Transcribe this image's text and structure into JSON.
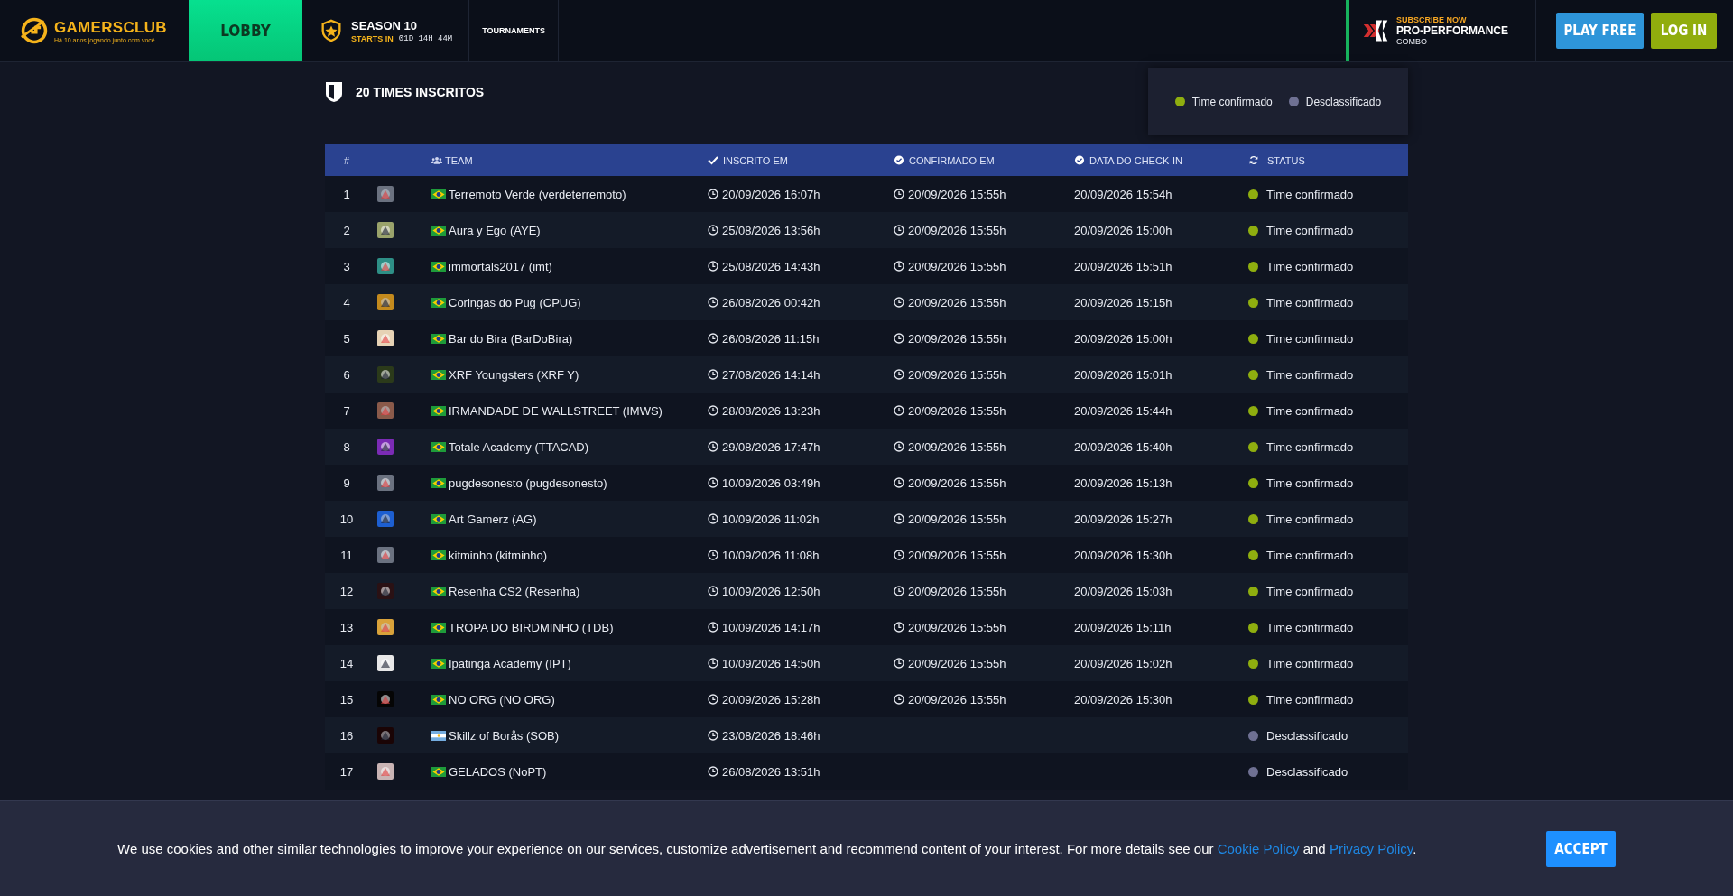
{
  "header": {
    "logo": {
      "name": "GAMERSCLUB",
      "tagline": "Há 10 anos jogando junto com você."
    },
    "nav": [
      {
        "label": "LOBBY",
        "selected": true
      }
    ],
    "season": {
      "title": "SEASON 10",
      "starts_label": "STARTS IN",
      "countdown": "01D 14H 44M"
    },
    "nav_more": [
      {
        "label": "TOURNAMENTS",
        "selected": false
      }
    ],
    "promo": {
      "eyebrow": "SUBSCRIBE NOW",
      "title": "PRO-PERFORMANCE",
      "subtitle": "COMBO"
    },
    "buttons": [
      {
        "label": "PLAY FREE",
        "kind": "play"
      },
      {
        "label": "LOG IN",
        "kind": "login"
      }
    ]
  },
  "section": {
    "title": "20 TIMES INSCRITOS"
  },
  "legend": [
    {
      "label": "Time confirmado",
      "color": "#8fae0f"
    },
    {
      "label": "Desclassificado",
      "color": "#6f7193"
    }
  ],
  "table": {
    "columns": [
      "#",
      "TEAM",
      "INSCRITO EM",
      "CONFIRMADO EM",
      "DATA DO CHECK-IN",
      "STATUS"
    ],
    "rows": [
      {
        "n": "1",
        "team": "Terremoto Verde (verdeterremoto)",
        "kind": "brazil",
        "inscrito": "20/09/2026 16:07h",
        "confirmado": "20/09/2026 15:55h",
        "checkin": "20/09/2026 15:54h",
        "status": "Time confirmado",
        "color": "#8fae0f"
      },
      {
        "n": "2",
        "team": "Aura y Ego (AYE)",
        "kind": "brazil",
        "inscrito": "25/08/2026 13:56h",
        "confirmado": "20/09/2026 15:55h",
        "checkin": "20/09/2026 15:00h",
        "status": "Time confirmado",
        "color": "#8fae0f"
      },
      {
        "n": "3",
        "team": "immortals2017 (imt)",
        "kind": "brazil",
        "inscrito": "25/08/2026 14:43h",
        "confirmado": "20/09/2026 15:55h",
        "checkin": "20/09/2026 15:51h",
        "status": "Time confirmado",
        "color": "#8fae0f"
      },
      {
        "n": "4",
        "team": "Coringas do Pug (CPUG)",
        "kind": "brazil",
        "inscrito": "26/08/2026 00:42h",
        "confirmado": "20/09/2026 15:55h",
        "checkin": "20/09/2026 15:15h",
        "status": "Time confirmado",
        "color": "#8fae0f"
      },
      {
        "n": "5",
        "team": "Bar do Bira (BarDoBira)",
        "kind": "brazil",
        "inscrito": "26/08/2026 11:15h",
        "confirmado": "20/09/2026 15:55h",
        "checkin": "20/09/2026 15:00h",
        "status": "Time confirmado",
        "color": "#8fae0f"
      },
      {
        "n": "6",
        "team": "XRF Youngsters (XRF Y)",
        "kind": "brazil",
        "inscrito": "27/08/2026 14:14h",
        "confirmado": "20/09/2026 15:55h",
        "checkin": "20/09/2026 15:01h",
        "status": "Time confirmado",
        "color": "#8fae0f"
      },
      {
        "n": "7",
        "team": "IRMANDADE DE WALLSTREET (IMWS)",
        "kind": "brazil",
        "inscrito": "28/08/2026 13:23h",
        "confirmado": "20/09/2026 15:55h",
        "checkin": "20/09/2026 15:44h",
        "status": "Time confirmado",
        "color": "#8fae0f"
      },
      {
        "n": "8",
        "team": "Totale Academy (TTACAD)",
        "kind": "brazil",
        "inscrito": "29/08/2026 17:47h",
        "confirmado": "20/09/2026 15:55h",
        "checkin": "20/09/2026 15:40h",
        "status": "Time confirmado",
        "color": "#8fae0f"
      },
      {
        "n": "9",
        "team": "pugdesonesto (pugdesonesto)",
        "kind": "brazil",
        "inscrito": "10/09/2026 03:49h",
        "confirmado": "20/09/2026 15:55h",
        "checkin": "20/09/2026 15:13h",
        "status": "Time confirmado",
        "color": "#8fae0f"
      },
      {
        "n": "10",
        "team": "Art Gamerz (AG)",
        "kind": "brazil",
        "inscrito": "10/09/2026 11:02h",
        "confirmado": "20/09/2026 15:55h",
        "checkin": "20/09/2026 15:27h",
        "status": "Time confirmado",
        "color": "#8fae0f"
      },
      {
        "n": "11",
        "team": "kitminho (kitminho)",
        "kind": "brazil",
        "inscrito": "10/09/2026 11:08h",
        "confirmado": "20/09/2026 15:55h",
        "checkin": "20/09/2026 15:30h",
        "status": "Time confirmado",
        "color": "#8fae0f"
      },
      {
        "n": "12",
        "team": "Resenha CS2 (Resenha)",
        "kind": "brazil",
        "inscrito": "10/09/2026 12:50h",
        "confirmado": "20/09/2026 15:55h",
        "checkin": "20/09/2026 15:03h",
        "status": "Time confirmado",
        "color": "#8fae0f"
      },
      {
        "n": "13",
        "team": "TROPA DO BIRDMINHO (TDB)",
        "kind": "brazil",
        "inscrito": "10/09/2026 14:17h",
        "confirmado": "20/09/2026 15:55h",
        "checkin": "20/09/2026 15:11h",
        "status": "Time confirmado",
        "color": "#8fae0f"
      },
      {
        "n": "14",
        "team": "Ipatinga Academy (IPT)",
        "kind": "brazil",
        "inscrito": "10/09/2026 14:50h",
        "confirmado": "20/09/2026 15:55h",
        "checkin": "20/09/2026 15:02h",
        "status": "Time confirmado",
        "color": "#8fae0f"
      },
      {
        "n": "15",
        "team": "NO ORG (NO ORG)",
        "kind": "brazil",
        "inscrito": "20/09/2026 15:28h",
        "confirmado": "20/09/2026 15:55h",
        "checkin": "20/09/2026 15:30h",
        "status": "Time confirmado",
        "color": "#8fae0f"
      },
      {
        "n": "16",
        "team": "Skillz of Borås (SOB)",
        "kind": "argentina",
        "inscrito": "23/08/2026 18:46h",
        "status": "Desclassificado",
        "color": "#6f7193"
      },
      {
        "n": "17",
        "team": "GELADOS (NoPT)",
        "kind": "brazil",
        "inscrito": "26/08/2026 13:51h",
        "status": "Desclassificado",
        "color": "#6f7193"
      }
    ]
  },
  "cookie": {
    "text": "We use cookies and other similar technologies to improve your experience on our services, customize advertisement and recommend content of your interest. For more details see our",
    "link1": "Cookie Policy",
    "and": "and",
    "link2": "Privacy Policy",
    "end": ".",
    "button": "ACCEPT"
  }
}
